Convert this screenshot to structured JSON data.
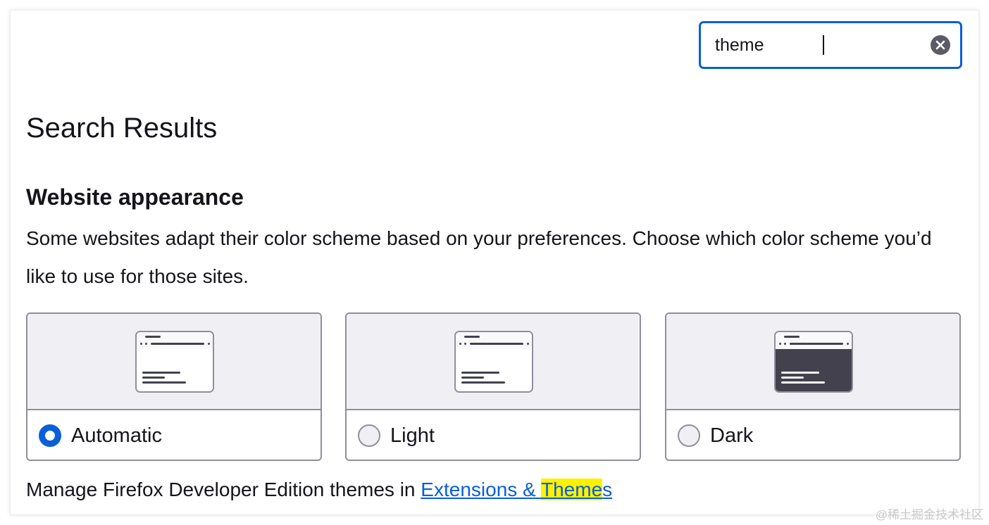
{
  "search": {
    "value": "theme",
    "clear_icon": "close-circle-icon"
  },
  "page": {
    "title": "Search Results"
  },
  "appearance": {
    "title": "Website appearance",
    "description": "Some websites adapt their color scheme based on your preferences. Choose which color scheme you’d like to use for those sites.",
    "options": [
      {
        "label": "Automatic",
        "checked": true,
        "preview_icon": "browser-light-preview-icon"
      },
      {
        "label": "Light",
        "checked": false,
        "preview_icon": "browser-light-preview-icon"
      },
      {
        "label": "Dark",
        "checked": false,
        "preview_icon": "browser-dark-preview-icon"
      }
    ]
  },
  "manage": {
    "prefix": "Manage Firefox Developer Edition themes in ",
    "link_before": "Extensions & ",
    "link_highlight": "Theme",
    "link_after": "s"
  },
  "watermark": "@稀土掘金技术社区",
  "colors": {
    "accent": "#0a5ed9",
    "highlight": "#fff200",
    "text": "#15141a",
    "dark_preview": "#42414d"
  }
}
